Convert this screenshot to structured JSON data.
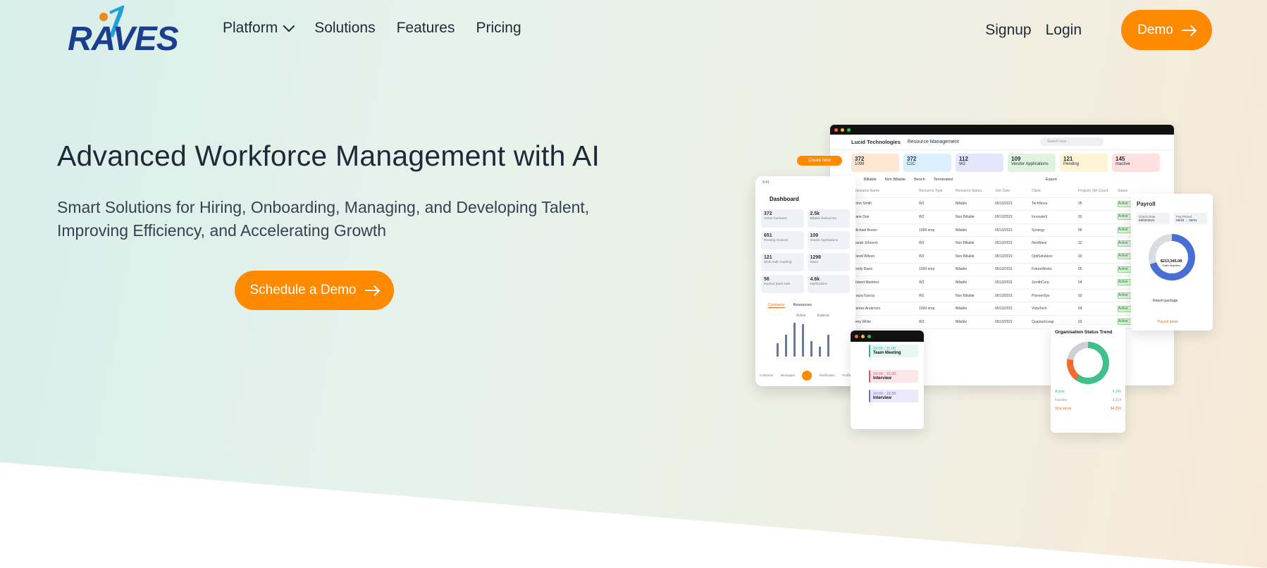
{
  "nav": {
    "logo_text": "RAVES",
    "links": [
      "Platform",
      "Solutions",
      "Features",
      "Pricing"
    ],
    "signup": "Signup",
    "login": "Login",
    "demo": "Demo"
  },
  "hero": {
    "title": "Advanced Workforce Management with AI",
    "subtitle": "Smart Solutions for Hiring, Onboarding, Managing, and Developing Talent, Improving Efficiency, and Accelerating Growth",
    "cta": "Schedule a Demo"
  },
  "mock_desktop": {
    "company": "Lucid Technologies",
    "section": "Resource Management",
    "search_placeholder": "Search here...",
    "stats": [
      {
        "n": "372",
        "label": "1099",
        "color": "#fde6d2"
      },
      {
        "n": "372",
        "label": "C2C",
        "color": "#dcefff"
      },
      {
        "n": "112",
        "label": "W2",
        "color": "#e4e6fb"
      },
      {
        "n": "109",
        "label": "Vendor Applications",
        "color": "#dff3df"
      },
      {
        "n": "121",
        "label": "Pending",
        "color": "#fff3d6"
      },
      {
        "n": "145",
        "label": "Inactive",
        "color": "#fde0e0"
      }
    ],
    "filters": [
      "Billable",
      "Non Billable",
      "Bench",
      "Terminated"
    ],
    "export": "Export",
    "columns": [
      "Resource Name",
      "Resource Type",
      "Resource Status",
      "Join Date",
      "Client",
      "Projects (W) Count",
      "Status",
      "Options"
    ],
    "rows": [
      [
        "John Smith",
        "W2",
        "Billable",
        "05/13/2021",
        "TechNova",
        "05"
      ],
      [
        "Jane Doe",
        "W2",
        "Non Billable",
        "05/13/2021",
        "InnovateX",
        "03"
      ],
      [
        "Michael Brown",
        "1099 emp",
        "Billable",
        "05/13/2021",
        "Synergy",
        "06"
      ],
      [
        "Sarah Johnson",
        "W2",
        "Non Billable",
        "05/13/2021",
        "NexWave",
        "12"
      ],
      [
        "David Wilson",
        "W2",
        "Non Billable",
        "05/13/2021",
        "OptiSolutions",
        "03"
      ],
      [
        "Emily Davis",
        "1099 emp",
        "Billable",
        "05/13/2021",
        "FutureWorks",
        "05"
      ],
      [
        "Robert Martinez",
        "W2",
        "Billable",
        "05/13/2021",
        "ZenithCorp",
        "04"
      ],
      [
        "Laura Garcia",
        "W2",
        "Non Billable",
        "05/13/2021",
        "PioneerSys",
        "03"
      ],
      [
        "James Anderson",
        "1099 emp",
        "Billable",
        "05/13/2021",
        "VistaTech",
        "04"
      ],
      [
        "Amy White",
        "W2",
        "Billable",
        "05/13/2021",
        "QuantumLeap",
        "03"
      ]
    ],
    "active_label": "Active"
  },
  "mock_phone": {
    "create_new": "Create New",
    "time": "9:41",
    "title": "Dashboard",
    "cards": [
      {
        "n": "372",
        "label": "Active Contracts"
      },
      {
        "n": "2.5k",
        "label": "Billable Resources"
      },
      {
        "n": "651",
        "label": "Pending Invoices"
      },
      {
        "n": "109",
        "label": "Vendor Applications"
      },
      {
        "n": "121",
        "label": "Work Auth. Expiring"
      },
      {
        "n": "1298",
        "label": "Notes"
      },
      {
        "n": "56",
        "label": "Expired Work Auth."
      },
      {
        "n": "4.6k",
        "label": "Notifications"
      }
    ],
    "tabs": [
      "Contracts",
      "Resources"
    ],
    "legend": [
      "Active",
      "Expired"
    ],
    "bar_values": [
      0.4,
      0.65,
      1.0,
      0.95,
      0.45,
      0.3,
      0.65
    ],
    "nav": [
      "Contracts",
      "Messages",
      "Notification",
      "Profile"
    ]
  },
  "mock_payroll": {
    "title": "Payroll",
    "check_date_label": "Check Date",
    "check_date": "06/02/2022",
    "pay_period_label": "Pay Period",
    "pay_period": "05/18 → 05/31",
    "amount": "$213,345.08",
    "amount_sub": "Cash required",
    "report": "Report package",
    "detail": "Payroll detail"
  },
  "mock_calendar": {
    "events": [
      {
        "time": "10:00 - 11:00",
        "title": "Team Meeting",
        "color": "#2bb5a0",
        "bg": "#e6f7f4"
      },
      {
        "time": "14:00 - 15:00",
        "title": "Interview",
        "color": "#e25563",
        "bg": "#fde6e8"
      },
      {
        "time": "16:00 - 16:30",
        "title": "Interview",
        "color": "#6a6fd9",
        "bg": "#e9e9fb"
      }
    ]
  },
  "mock_trend": {
    "title": "Organisation Status Trend",
    "legend": [
      {
        "label": "Active",
        "value": "9,245"
      },
      {
        "label": "Inactive",
        "value": "3,314"
      },
      {
        "label": "Vice versa",
        "value": "$4,250"
      }
    ]
  }
}
